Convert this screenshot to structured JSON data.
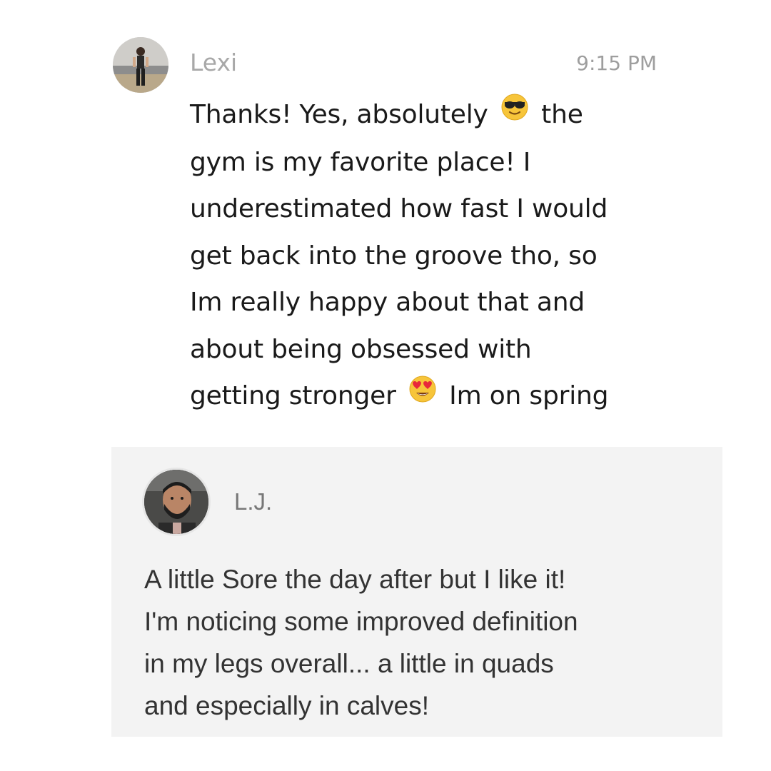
{
  "messages": [
    {
      "sender": "Lexi",
      "time": "9:15 PM",
      "avatar_icon": "profile-photo",
      "lines": [
        "Thanks! Yes, absolutely",
        "the",
        "gym is my favorite place! I",
        "underestimated how fast I would",
        "get back into the groove tho, so",
        "Im really happy about that and",
        "about being obsessed with",
        "getting stronger",
        "Im on spring"
      ],
      "emojis": [
        "sunglasses-emoji",
        "heart-eyes-emoji"
      ]
    },
    {
      "sender": "L.J.",
      "avatar_icon": "profile-photo",
      "lines": [
        "A little Sore the day after but I like it!",
        "I'm noticing some improved definition",
        "in my legs overall... a little in quads",
        "and especially in calves!"
      ]
    }
  ],
  "colors": {
    "card1_bg": "#ffffff",
    "card2_bg": "#f3f3f3",
    "name_gray": "#a8a8a8",
    "text_dark": "#1a1a1a"
  }
}
